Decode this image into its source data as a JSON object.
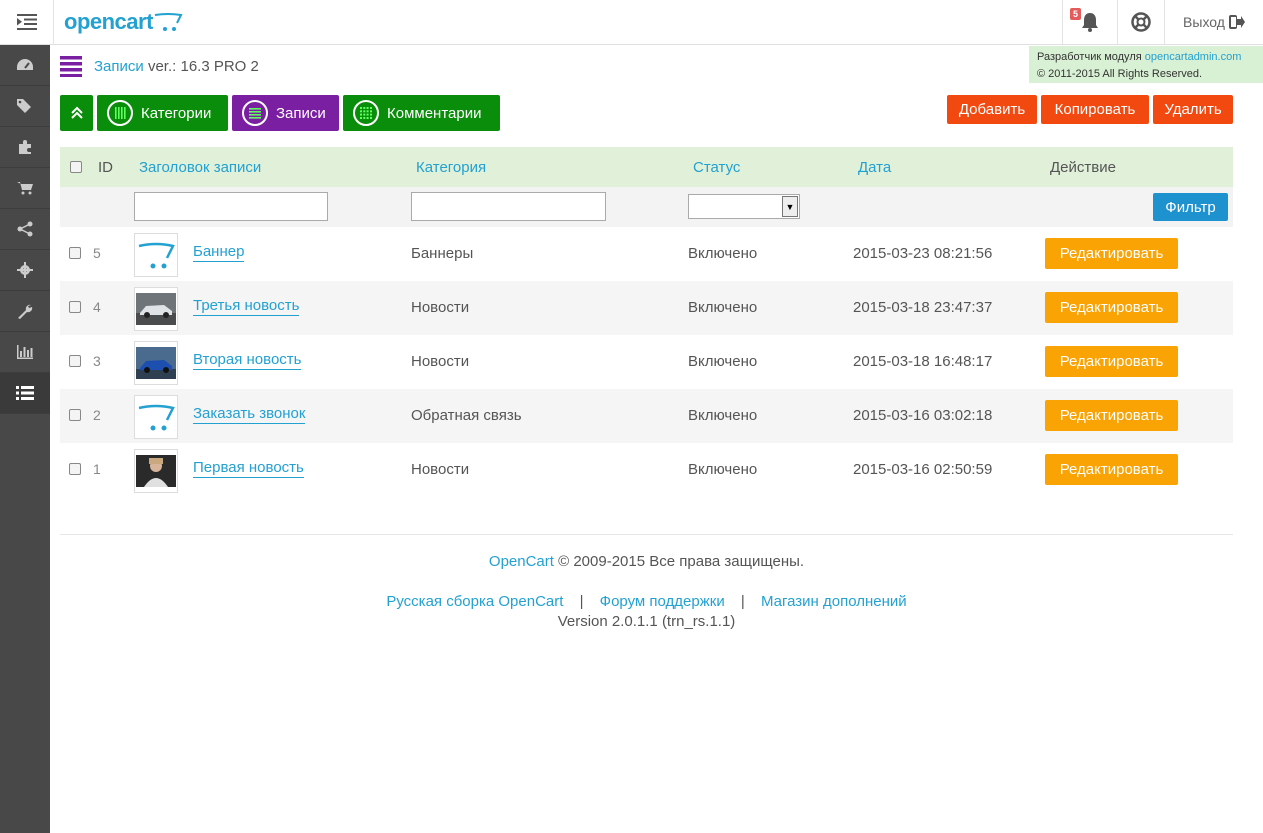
{
  "header": {
    "logo": "opencart",
    "notifications_count": "5",
    "logout_label": "Выход"
  },
  "sidebar": {
    "items": [
      "dashboard-icon",
      "tags-icon",
      "puzzle-icon",
      "cart-icon",
      "share-icon",
      "gear-icon",
      "wrench-icon",
      "bar-chart-icon",
      "list-icon"
    ],
    "active_index": 8
  },
  "devinfo": {
    "line1_prefix": "Разработчик модуля",
    "line1_link": "opencartadmin.com",
    "line2": "© 2011-2015 All Rights Reserved."
  },
  "page": {
    "title_link": "Записи",
    "version": "ver.: 16.3 PRO 2"
  },
  "nav": {
    "categories": "Категории",
    "records": "Записи",
    "comments": "Комментарии"
  },
  "actions": {
    "add": "Добавить",
    "copy": "Копировать",
    "delete": "Удалить"
  },
  "table": {
    "headers": {
      "id": "ID",
      "title": "Заголовок записи",
      "category": "Категория",
      "status": "Статус",
      "date": "Дата",
      "action": "Действие"
    },
    "filter_label": "Фильтр",
    "edit_label": "Редактировать",
    "rows": [
      {
        "id": "5",
        "title": "Баннер",
        "category": "Баннеры",
        "status": "Включено",
        "date": "2015-03-23 08:21:56",
        "thumb": "cart-logo"
      },
      {
        "id": "4",
        "title": "Третья новость",
        "category": "Новости",
        "status": "Включено",
        "date": "2015-03-18 23:47:37",
        "thumb": "silver-car"
      },
      {
        "id": "3",
        "title": "Вторая новость",
        "category": "Новости",
        "status": "Включено",
        "date": "2015-03-18 16:48:17",
        "thumb": "blue-car"
      },
      {
        "id": "2",
        "title": "Заказать звонок",
        "category": "Обратная связь",
        "status": "Включено",
        "date": "2015-03-16 03:02:18",
        "thumb": "cart-logo"
      },
      {
        "id": "1",
        "title": "Первая новость",
        "category": "Новости",
        "status": "Включено",
        "date": "2015-03-16 02:50:59",
        "thumb": "person-photo"
      }
    ]
  },
  "footer": {
    "brand": "OpenCart",
    "copyright": "© 2009-2015 Все права защищены.",
    "link1": "Русская сборка OpenCart",
    "link2": "Форум поддержки",
    "link3": "Магазин дополнений",
    "separator": "|",
    "version": "Version 2.0.1.1 (trn_rs.1.1)"
  },
  "colors": {
    "accent": "#23a1d1",
    "green": "#0a8d0a",
    "purple": "#7b1fa2",
    "red": "#f24911",
    "orange": "#f9a305"
  }
}
